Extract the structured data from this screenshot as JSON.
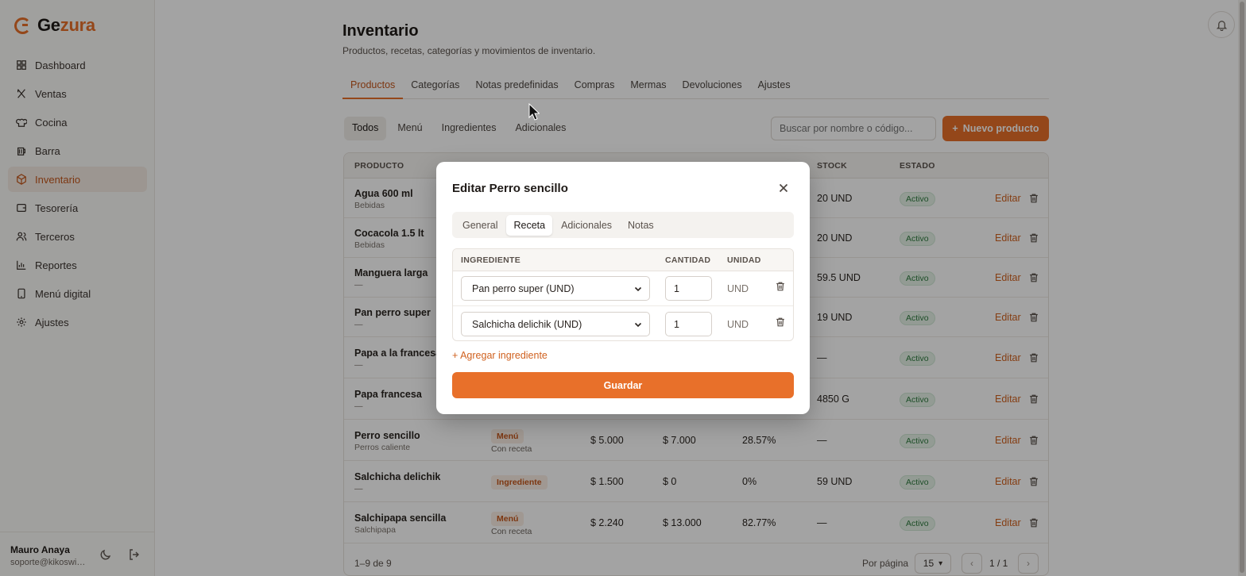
{
  "brand": {
    "name_a": "Ge",
    "name_b": "zura",
    "accent": "#e8702a"
  },
  "sidebar": {
    "items": [
      {
        "label": "Dashboard",
        "icon": "grid-icon"
      },
      {
        "label": "Ventas",
        "icon": "utensils-icon"
      },
      {
        "label": "Cocina",
        "icon": "chef-hat-icon"
      },
      {
        "label": "Barra",
        "icon": "beer-icon"
      },
      {
        "label": "Inventario",
        "icon": "box-icon",
        "active": true
      },
      {
        "label": "Tesorería",
        "icon": "wallet-icon"
      },
      {
        "label": "Terceros",
        "icon": "users-icon"
      },
      {
        "label": "Reportes",
        "icon": "bar-chart-icon"
      },
      {
        "label": "Menú digital",
        "icon": "tablet-icon"
      },
      {
        "label": "Ajustes",
        "icon": "gear-icon"
      }
    ],
    "user": {
      "name": "Mauro Anaya",
      "email": "soporte@kikoswill..."
    }
  },
  "page": {
    "title": "Inventario",
    "subtitle": "Productos, recetas, categorías y movimientos de inventario.",
    "tabs": [
      "Productos",
      "Categorías",
      "Notas predefinidas",
      "Compras",
      "Mermas",
      "Devoluciones",
      "Ajustes"
    ],
    "active_tab": "Productos"
  },
  "filters": {
    "pills": [
      "Todos",
      "Menú",
      "Ingredientes",
      "Adicionales"
    ],
    "active": "Todos",
    "search_placeholder": "Buscar por nombre o código...",
    "new_button": "Nuevo producto"
  },
  "table": {
    "headers": {
      "producto": "PRODUCTO",
      "stock": "STOCK",
      "estado": "ESTADO"
    },
    "edit_label": "Editar",
    "rows": [
      {
        "name": "Agua 600 ml",
        "category": "Bebidas",
        "tipo": "",
        "tipo_sub": "",
        "costo": "",
        "precio": "",
        "margen": "",
        "stock": "20 UND",
        "estado": "Activo"
      },
      {
        "name": "Cocacola 1.5 lt",
        "category": "Bebidas",
        "tipo": "",
        "tipo_sub": "",
        "costo": "",
        "precio": "",
        "margen": "",
        "stock": "20 UND",
        "estado": "Activo"
      },
      {
        "name": "Manguera larga",
        "category": "—",
        "tipo": "",
        "tipo_sub": "",
        "costo": "",
        "precio": "",
        "margen": "",
        "stock": "59.5 UND",
        "estado": "Activo"
      },
      {
        "name": "Pan perro super",
        "category": "—",
        "tipo": "",
        "tipo_sub": "",
        "costo": "",
        "precio": "",
        "margen": "",
        "stock": "19 UND",
        "estado": "Activo"
      },
      {
        "name": "Papa a la francesa",
        "category": "—",
        "tipo": "",
        "tipo_sub": "",
        "costo": "",
        "precio": "",
        "margen": "",
        "stock": "—",
        "estado": "Activo"
      },
      {
        "name": "Papa francesa",
        "category": "—",
        "tipo": "",
        "tipo_sub": "",
        "costo": "",
        "precio": "",
        "margen": "",
        "stock": "4850 G",
        "estado": "Activo"
      },
      {
        "name": "Perro sencillo",
        "category": "Perros caliente",
        "tipo": "Menú",
        "tipo_sub": "Con receta",
        "costo": "$ 5.000",
        "precio": "$ 7.000",
        "margen": "28.57%",
        "stock": "—",
        "estado": "Activo"
      },
      {
        "name": "Salchicha delichik",
        "category": "—",
        "tipo": "Ingrediente",
        "tipo_sub": "",
        "costo": "$ 1.500",
        "precio": "$ 0",
        "margen": "0%",
        "stock": "59 UND",
        "estado": "Activo"
      },
      {
        "name": "Salchipapa sencilla",
        "category": "Salchipapa",
        "tipo": "Menú",
        "tipo_sub": "Con receta",
        "costo": "$ 2.240",
        "precio": "$ 13.000",
        "margen": "82.77%",
        "stock": "—",
        "estado": "Activo"
      }
    ],
    "footer": {
      "count": "1–9 de 9",
      "per_page_label": "Por página",
      "per_page_value": "15",
      "page": "1 / 1"
    }
  },
  "modal": {
    "title": "Editar Perro sencillo",
    "tabs": [
      "General",
      "Receta",
      "Adicionales",
      "Notas"
    ],
    "active_tab": "Receta",
    "headers": {
      "ingrediente": "INGREDIENTE",
      "cantidad": "CANTIDAD",
      "unidad": "UNIDAD"
    },
    "ingredients": [
      {
        "name": "Pan perro super (UND)",
        "qty": "1",
        "unit": "UND"
      },
      {
        "name": "Salchicha delichik (UND)",
        "qty": "1",
        "unit": "UND"
      }
    ],
    "add_label": "+ Agregar ingrediente",
    "save_label": "Guardar"
  }
}
